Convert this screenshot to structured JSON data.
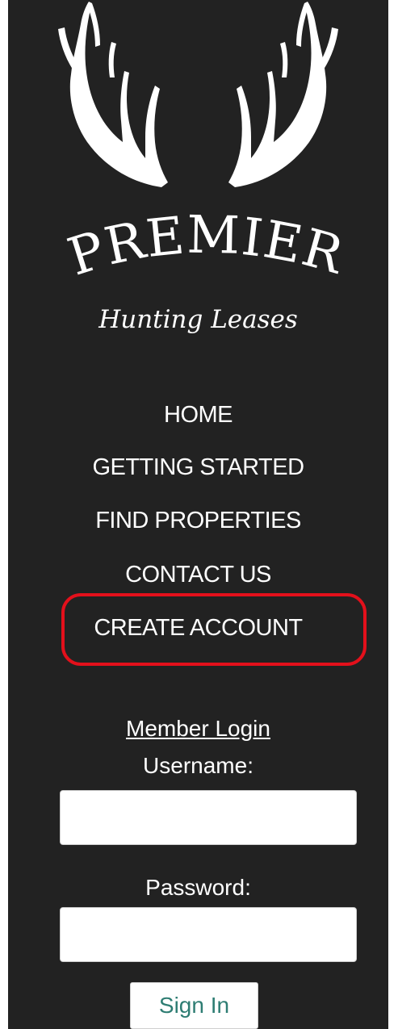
{
  "brand": {
    "name": "PREMIER",
    "tagline": "Hunting Leases"
  },
  "nav": {
    "items": [
      {
        "label": "HOME"
      },
      {
        "label": "GETTING STARTED"
      },
      {
        "label": "FIND PROPERTIES"
      },
      {
        "label": "CONTACT US"
      },
      {
        "label": "CREATE ACCOUNT"
      }
    ]
  },
  "login": {
    "title": "Member Login",
    "username_label": "Username:",
    "username_value": "",
    "password_label": "Password:",
    "password_value": "",
    "submit_label": "Sign In"
  },
  "colors": {
    "panel_background": "#222222",
    "text": "#ffffff",
    "highlight_border": "#e3101b",
    "signin_text": "#2e7d73"
  },
  "icons": {
    "logo_graphic": "antlers-icon"
  }
}
